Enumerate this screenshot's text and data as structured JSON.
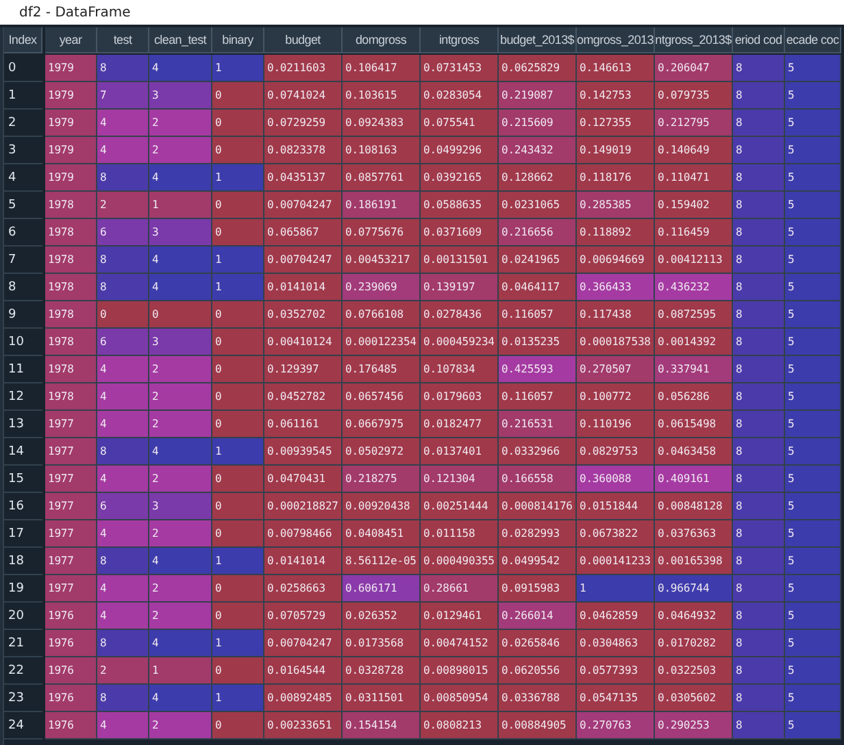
{
  "window": {
    "title": "df2 - DataFrame"
  },
  "table": {
    "index_header": "Index",
    "columns": [
      "year",
      "test",
      "clean_test",
      "binary",
      "budget",
      "domgross",
      "intgross",
      "budget_2013$",
      "omgross_2013",
      "ntgross_2013$",
      "eriod cod",
      "ecade coc"
    ],
    "rows": [
      {
        "index": "0",
        "cells": [
          {
            "value": "1979",
            "color": "#a23a6a"
          },
          {
            "value": "8",
            "color": "#4b3aaa"
          },
          {
            "value": "4",
            "color": "#3c3cac"
          },
          {
            "value": "1",
            "color": "#3c3cac"
          },
          {
            "value": "0.0211603",
            "color": "#a0394a"
          },
          {
            "value": "0.106417",
            "color": "#a0394a"
          },
          {
            "value": "0.0731453",
            "color": "#a0394a"
          },
          {
            "value": "0.0625829",
            "color": "#a0394a"
          },
          {
            "value": "0.146613",
            "color": "#a0394a"
          },
          {
            "value": "0.206047",
            "color": "#a23a6a"
          },
          {
            "value": "8",
            "color": "#4b3aaa"
          },
          {
            "value": "5",
            "color": "#3c3cac"
          }
        ]
      },
      {
        "index": "1",
        "cells": [
          {
            "value": "1979",
            "color": "#a23a6a"
          },
          {
            "value": "7",
            "color": "#7a3aaa"
          },
          {
            "value": "3",
            "color": "#7a3aaa"
          },
          {
            "value": "0",
            "color": "#a0394a"
          },
          {
            "value": "0.0741024",
            "color": "#a0394a"
          },
          {
            "value": "0.103615",
            "color": "#a0394a"
          },
          {
            "value": "0.0283054",
            "color": "#a0394a"
          },
          {
            "value": "0.219087",
            "color": "#a23a6a"
          },
          {
            "value": "0.142753",
            "color": "#a0394a"
          },
          {
            "value": "0.079735",
            "color": "#a0394a"
          },
          {
            "value": "8",
            "color": "#4b3aaa"
          },
          {
            "value": "5",
            "color": "#3c3cac"
          }
        ]
      },
      {
        "index": "2",
        "cells": [
          {
            "value": "1979",
            "color": "#a23a6a"
          },
          {
            "value": "4",
            "color": "#a53aa2"
          },
          {
            "value": "2",
            "color": "#a53aa2"
          },
          {
            "value": "0",
            "color": "#a0394a"
          },
          {
            "value": "0.0729259",
            "color": "#a0394a"
          },
          {
            "value": "0.0924383",
            "color": "#a0394a"
          },
          {
            "value": "0.075541",
            "color": "#a0394a"
          },
          {
            "value": "0.215609",
            "color": "#a23a6a"
          },
          {
            "value": "0.127355",
            "color": "#a0394a"
          },
          {
            "value": "0.212795",
            "color": "#a23a6a"
          },
          {
            "value": "8",
            "color": "#4b3aaa"
          },
          {
            "value": "5",
            "color": "#3c3cac"
          }
        ]
      },
      {
        "index": "3",
        "cells": [
          {
            "value": "1979",
            "color": "#a23a6a"
          },
          {
            "value": "4",
            "color": "#a53aa2"
          },
          {
            "value": "2",
            "color": "#a53aa2"
          },
          {
            "value": "0",
            "color": "#a0394a"
          },
          {
            "value": "0.0823378",
            "color": "#a0394a"
          },
          {
            "value": "0.108163",
            "color": "#a0394a"
          },
          {
            "value": "0.0499296",
            "color": "#a0394a"
          },
          {
            "value": "0.243432",
            "color": "#a23a6a"
          },
          {
            "value": "0.149019",
            "color": "#a0394a"
          },
          {
            "value": "0.140649",
            "color": "#a0394a"
          },
          {
            "value": "8",
            "color": "#4b3aaa"
          },
          {
            "value": "5",
            "color": "#3c3cac"
          }
        ]
      },
      {
        "index": "4",
        "cells": [
          {
            "value": "1979",
            "color": "#a23a6a"
          },
          {
            "value": "8",
            "color": "#4b3aaa"
          },
          {
            "value": "4",
            "color": "#3c3cac"
          },
          {
            "value": "1",
            "color": "#3c3cac"
          },
          {
            "value": "0.0435137",
            "color": "#a0394a"
          },
          {
            "value": "0.0857761",
            "color": "#a0394a"
          },
          {
            "value": "0.0392165",
            "color": "#a0394a"
          },
          {
            "value": "0.128662",
            "color": "#a0394a"
          },
          {
            "value": "0.118176",
            "color": "#a0394a"
          },
          {
            "value": "0.110471",
            "color": "#a0394a"
          },
          {
            "value": "8",
            "color": "#4b3aaa"
          },
          {
            "value": "5",
            "color": "#3c3cac"
          }
        ]
      },
      {
        "index": "5",
        "cells": [
          {
            "value": "1978",
            "color": "#a23a6a"
          },
          {
            "value": "2",
            "color": "#a23a6a"
          },
          {
            "value": "1",
            "color": "#a23a6a"
          },
          {
            "value": "0",
            "color": "#a0394a"
          },
          {
            "value": "0.00704247",
            "color": "#a0394a"
          },
          {
            "value": "0.186191",
            "color": "#a23a6a"
          },
          {
            "value": "0.0588635",
            "color": "#a0394a"
          },
          {
            "value": "0.0231065",
            "color": "#a0394a"
          },
          {
            "value": "0.285385",
            "color": "#a23a6a"
          },
          {
            "value": "0.159402",
            "color": "#a0394a"
          },
          {
            "value": "8",
            "color": "#4b3aaa"
          },
          {
            "value": "5",
            "color": "#3c3cac"
          }
        ]
      },
      {
        "index": "6",
        "cells": [
          {
            "value": "1978",
            "color": "#a23a6a"
          },
          {
            "value": "6",
            "color": "#7a3aaa"
          },
          {
            "value": "3",
            "color": "#7a3aaa"
          },
          {
            "value": "0",
            "color": "#a0394a"
          },
          {
            "value": "0.065867",
            "color": "#a0394a"
          },
          {
            "value": "0.0775676",
            "color": "#a0394a"
          },
          {
            "value": "0.0371609",
            "color": "#a0394a"
          },
          {
            "value": "0.216656",
            "color": "#a23a6a"
          },
          {
            "value": "0.118892",
            "color": "#a0394a"
          },
          {
            "value": "0.116459",
            "color": "#a0394a"
          },
          {
            "value": "8",
            "color": "#4b3aaa"
          },
          {
            "value": "5",
            "color": "#3c3cac"
          }
        ]
      },
      {
        "index": "7",
        "cells": [
          {
            "value": "1978",
            "color": "#a23a6a"
          },
          {
            "value": "8",
            "color": "#4b3aaa"
          },
          {
            "value": "4",
            "color": "#3c3cac"
          },
          {
            "value": "1",
            "color": "#3c3cac"
          },
          {
            "value": "0.00704247",
            "color": "#a0394a"
          },
          {
            "value": "0.00453217",
            "color": "#a0394a"
          },
          {
            "value": "0.00131501",
            "color": "#a0394a"
          },
          {
            "value": "0.0241965",
            "color": "#a0394a"
          },
          {
            "value": "0.00694669",
            "color": "#a0394a"
          },
          {
            "value": "0.00412113",
            "color": "#a0394a"
          },
          {
            "value": "8",
            "color": "#4b3aaa"
          },
          {
            "value": "5",
            "color": "#3c3cac"
          }
        ]
      },
      {
        "index": "8",
        "cells": [
          {
            "value": "1978",
            "color": "#a23a6a"
          },
          {
            "value": "8",
            "color": "#4b3aaa"
          },
          {
            "value": "4",
            "color": "#3c3cac"
          },
          {
            "value": "1",
            "color": "#3c3cac"
          },
          {
            "value": "0.0141014",
            "color": "#a0394a"
          },
          {
            "value": "0.239069",
            "color": "#a33a7a"
          },
          {
            "value": "0.139197",
            "color": "#a23a6a"
          },
          {
            "value": "0.0464117",
            "color": "#a0394a"
          },
          {
            "value": "0.366433",
            "color": "#a53aa2"
          },
          {
            "value": "0.436232",
            "color": "#a53aa2"
          },
          {
            "value": "8",
            "color": "#4b3aaa"
          },
          {
            "value": "5",
            "color": "#3c3cac"
          }
        ]
      },
      {
        "index": "9",
        "cells": [
          {
            "value": "1978",
            "color": "#a23a6a"
          },
          {
            "value": "0",
            "color": "#a0394a"
          },
          {
            "value": "0",
            "color": "#a0394a"
          },
          {
            "value": "0",
            "color": "#a0394a"
          },
          {
            "value": "0.0352702",
            "color": "#a0394a"
          },
          {
            "value": "0.0766108",
            "color": "#a0394a"
          },
          {
            "value": "0.0278436",
            "color": "#a0394a"
          },
          {
            "value": "0.116057",
            "color": "#a0394a"
          },
          {
            "value": "0.117438",
            "color": "#a0394a"
          },
          {
            "value": "0.0872595",
            "color": "#a0394a"
          },
          {
            "value": "8",
            "color": "#4b3aaa"
          },
          {
            "value": "5",
            "color": "#3c3cac"
          }
        ]
      },
      {
        "index": "10",
        "cells": [
          {
            "value": "1978",
            "color": "#a23a6a"
          },
          {
            "value": "6",
            "color": "#7a3aaa"
          },
          {
            "value": "3",
            "color": "#7a3aaa"
          },
          {
            "value": "0",
            "color": "#a0394a"
          },
          {
            "value": "0.00410124",
            "color": "#a0394a"
          },
          {
            "value": "0.000122354",
            "color": "#a0394a"
          },
          {
            "value": "0.000459234",
            "color": "#a0394a"
          },
          {
            "value": "0.0135235",
            "color": "#a0394a"
          },
          {
            "value": "0.000187538",
            "color": "#a0394a"
          },
          {
            "value": "0.0014392",
            "color": "#a0394a"
          },
          {
            "value": "8",
            "color": "#4b3aaa"
          },
          {
            "value": "5",
            "color": "#3c3cac"
          }
        ]
      },
      {
        "index": "11",
        "cells": [
          {
            "value": "1978",
            "color": "#a23a6a"
          },
          {
            "value": "4",
            "color": "#a53aa2"
          },
          {
            "value": "2",
            "color": "#a53aa2"
          },
          {
            "value": "0",
            "color": "#a0394a"
          },
          {
            "value": "0.129397",
            "color": "#a0394a"
          },
          {
            "value": "0.176485",
            "color": "#a0394a"
          },
          {
            "value": "0.107834",
            "color": "#a0394a"
          },
          {
            "value": "0.425593",
            "color": "#a53aa2"
          },
          {
            "value": "0.270507",
            "color": "#a23a6a"
          },
          {
            "value": "0.337941",
            "color": "#a33a7a"
          },
          {
            "value": "8",
            "color": "#4b3aaa"
          },
          {
            "value": "5",
            "color": "#3c3cac"
          }
        ]
      },
      {
        "index": "12",
        "cells": [
          {
            "value": "1978",
            "color": "#a23a6a"
          },
          {
            "value": "4",
            "color": "#a53aa2"
          },
          {
            "value": "2",
            "color": "#a53aa2"
          },
          {
            "value": "0",
            "color": "#a0394a"
          },
          {
            "value": "0.0452782",
            "color": "#a0394a"
          },
          {
            "value": "0.0657456",
            "color": "#a0394a"
          },
          {
            "value": "0.0179603",
            "color": "#a0394a"
          },
          {
            "value": "0.116057",
            "color": "#a0394a"
          },
          {
            "value": "0.100772",
            "color": "#a0394a"
          },
          {
            "value": "0.056286",
            "color": "#a0394a"
          },
          {
            "value": "8",
            "color": "#4b3aaa"
          },
          {
            "value": "5",
            "color": "#3c3cac"
          }
        ]
      },
      {
        "index": "13",
        "cells": [
          {
            "value": "1977",
            "color": "#a23a6a"
          },
          {
            "value": "4",
            "color": "#a53aa2"
          },
          {
            "value": "2",
            "color": "#a53aa2"
          },
          {
            "value": "0",
            "color": "#a0394a"
          },
          {
            "value": "0.061161",
            "color": "#a0394a"
          },
          {
            "value": "0.0667975",
            "color": "#a0394a"
          },
          {
            "value": "0.0182477",
            "color": "#a0394a"
          },
          {
            "value": "0.216531",
            "color": "#a23a6a"
          },
          {
            "value": "0.110196",
            "color": "#a0394a"
          },
          {
            "value": "0.0615498",
            "color": "#a0394a"
          },
          {
            "value": "8",
            "color": "#4b3aaa"
          },
          {
            "value": "5",
            "color": "#3c3cac"
          }
        ]
      },
      {
        "index": "14",
        "cells": [
          {
            "value": "1977",
            "color": "#a23a6a"
          },
          {
            "value": "8",
            "color": "#4b3aaa"
          },
          {
            "value": "4",
            "color": "#3c3cac"
          },
          {
            "value": "1",
            "color": "#3c3cac"
          },
          {
            "value": "0.00939545",
            "color": "#a0394a"
          },
          {
            "value": "0.0502972",
            "color": "#a0394a"
          },
          {
            "value": "0.0137401",
            "color": "#a0394a"
          },
          {
            "value": "0.0332966",
            "color": "#a0394a"
          },
          {
            "value": "0.0829753",
            "color": "#a0394a"
          },
          {
            "value": "0.0463458",
            "color": "#a0394a"
          },
          {
            "value": "8",
            "color": "#4b3aaa"
          },
          {
            "value": "5",
            "color": "#3c3cac"
          }
        ]
      },
      {
        "index": "15",
        "cells": [
          {
            "value": "1977",
            "color": "#a23a6a"
          },
          {
            "value": "4",
            "color": "#a53aa2"
          },
          {
            "value": "2",
            "color": "#a53aa2"
          },
          {
            "value": "0",
            "color": "#a0394a"
          },
          {
            "value": "0.0470431",
            "color": "#a0394a"
          },
          {
            "value": "0.218275",
            "color": "#a23a6a"
          },
          {
            "value": "0.121304",
            "color": "#a23a6a"
          },
          {
            "value": "0.166558",
            "color": "#a23a6a"
          },
          {
            "value": "0.360088",
            "color": "#a53aa2"
          },
          {
            "value": "0.409161",
            "color": "#a53aa2"
          },
          {
            "value": "8",
            "color": "#4b3aaa"
          },
          {
            "value": "5",
            "color": "#3c3cac"
          }
        ]
      },
      {
        "index": "16",
        "cells": [
          {
            "value": "1977",
            "color": "#a23a6a"
          },
          {
            "value": "6",
            "color": "#7a3aaa"
          },
          {
            "value": "3",
            "color": "#7a3aaa"
          },
          {
            "value": "0",
            "color": "#a0394a"
          },
          {
            "value": "0.000218827",
            "color": "#a0394a"
          },
          {
            "value": "0.00920438",
            "color": "#a0394a"
          },
          {
            "value": "0.00251444",
            "color": "#a0394a"
          },
          {
            "value": "0.000814176",
            "color": "#a0394a"
          },
          {
            "value": "0.0151844",
            "color": "#a0394a"
          },
          {
            "value": "0.00848128",
            "color": "#a0394a"
          },
          {
            "value": "8",
            "color": "#4b3aaa"
          },
          {
            "value": "5",
            "color": "#3c3cac"
          }
        ]
      },
      {
        "index": "17",
        "cells": [
          {
            "value": "1977",
            "color": "#a23a6a"
          },
          {
            "value": "4",
            "color": "#a53aa2"
          },
          {
            "value": "2",
            "color": "#a53aa2"
          },
          {
            "value": "0",
            "color": "#a0394a"
          },
          {
            "value": "0.00798466",
            "color": "#a0394a"
          },
          {
            "value": "0.0408451",
            "color": "#a0394a"
          },
          {
            "value": "0.011158",
            "color": "#a0394a"
          },
          {
            "value": "0.0282993",
            "color": "#a0394a"
          },
          {
            "value": "0.0673822",
            "color": "#a0394a"
          },
          {
            "value": "0.0376363",
            "color": "#a0394a"
          },
          {
            "value": "8",
            "color": "#4b3aaa"
          },
          {
            "value": "5",
            "color": "#3c3cac"
          }
        ]
      },
      {
        "index": "18",
        "cells": [
          {
            "value": "1977",
            "color": "#a23a6a"
          },
          {
            "value": "8",
            "color": "#4b3aaa"
          },
          {
            "value": "4",
            "color": "#3c3cac"
          },
          {
            "value": "1",
            "color": "#3c3cac"
          },
          {
            "value": "0.0141014",
            "color": "#a0394a"
          },
          {
            "value": "8.56112e-05",
            "color": "#a0394a"
          },
          {
            "value": "0.000490355",
            "color": "#a0394a"
          },
          {
            "value": "0.0499542",
            "color": "#a0394a"
          },
          {
            "value": "0.000141233",
            "color": "#a0394a"
          },
          {
            "value": "0.00165398",
            "color": "#a0394a"
          },
          {
            "value": "8",
            "color": "#4b3aaa"
          },
          {
            "value": "5",
            "color": "#3c3cac"
          }
        ]
      },
      {
        "index": "19",
        "cells": [
          {
            "value": "1977",
            "color": "#a23a6a"
          },
          {
            "value": "4",
            "color": "#a53aa2"
          },
          {
            "value": "2",
            "color": "#a53aa2"
          },
          {
            "value": "0",
            "color": "#a0394a"
          },
          {
            "value": "0.0258663",
            "color": "#a0394a"
          },
          {
            "value": "0.606171",
            "color": "#8a3aaa"
          },
          {
            "value": "0.28661",
            "color": "#a23a6a"
          },
          {
            "value": "0.0915983",
            "color": "#a0394a"
          },
          {
            "value": "1",
            "color": "#3c3cac"
          },
          {
            "value": "0.966744",
            "color": "#3e3cac"
          },
          {
            "value": "8",
            "color": "#4b3aaa"
          },
          {
            "value": "5",
            "color": "#3c3cac"
          }
        ]
      },
      {
        "index": "20",
        "cells": [
          {
            "value": "1976",
            "color": "#a23a6a"
          },
          {
            "value": "4",
            "color": "#a53aa2"
          },
          {
            "value": "2",
            "color": "#a53aa2"
          },
          {
            "value": "0",
            "color": "#a0394a"
          },
          {
            "value": "0.0705729",
            "color": "#a0394a"
          },
          {
            "value": "0.026352",
            "color": "#a0394a"
          },
          {
            "value": "0.0129461",
            "color": "#a0394a"
          },
          {
            "value": "0.266014",
            "color": "#a33a7a"
          },
          {
            "value": "0.0462859",
            "color": "#a0394a"
          },
          {
            "value": "0.0464932",
            "color": "#a0394a"
          },
          {
            "value": "8",
            "color": "#4b3aaa"
          },
          {
            "value": "5",
            "color": "#3c3cac"
          }
        ]
      },
      {
        "index": "21",
        "cells": [
          {
            "value": "1976",
            "color": "#a23a6a"
          },
          {
            "value": "8",
            "color": "#4b3aaa"
          },
          {
            "value": "4",
            "color": "#3c3cac"
          },
          {
            "value": "1",
            "color": "#3c3cac"
          },
          {
            "value": "0.00704247",
            "color": "#a0394a"
          },
          {
            "value": "0.0173568",
            "color": "#a0394a"
          },
          {
            "value": "0.00474152",
            "color": "#a0394a"
          },
          {
            "value": "0.0265846",
            "color": "#a0394a"
          },
          {
            "value": "0.0304863",
            "color": "#a0394a"
          },
          {
            "value": "0.0170282",
            "color": "#a0394a"
          },
          {
            "value": "8",
            "color": "#4b3aaa"
          },
          {
            "value": "5",
            "color": "#3c3cac"
          }
        ]
      },
      {
        "index": "22",
        "cells": [
          {
            "value": "1976",
            "color": "#a23a6a"
          },
          {
            "value": "2",
            "color": "#a23a6a"
          },
          {
            "value": "1",
            "color": "#a23a6a"
          },
          {
            "value": "0",
            "color": "#a0394a"
          },
          {
            "value": "0.0164544",
            "color": "#a0394a"
          },
          {
            "value": "0.0328728",
            "color": "#a0394a"
          },
          {
            "value": "0.00898015",
            "color": "#a0394a"
          },
          {
            "value": "0.0620556",
            "color": "#a0394a"
          },
          {
            "value": "0.0577393",
            "color": "#a0394a"
          },
          {
            "value": "0.0322503",
            "color": "#a0394a"
          },
          {
            "value": "8",
            "color": "#4b3aaa"
          },
          {
            "value": "5",
            "color": "#3c3cac"
          }
        ]
      },
      {
        "index": "23",
        "cells": [
          {
            "value": "1976",
            "color": "#a23a6a"
          },
          {
            "value": "8",
            "color": "#4b3aaa"
          },
          {
            "value": "4",
            "color": "#3c3cac"
          },
          {
            "value": "1",
            "color": "#3c3cac"
          },
          {
            "value": "0.00892485",
            "color": "#a0394a"
          },
          {
            "value": "0.0311501",
            "color": "#a0394a"
          },
          {
            "value": "0.00850954",
            "color": "#a0394a"
          },
          {
            "value": "0.0336788",
            "color": "#a0394a"
          },
          {
            "value": "0.0547135",
            "color": "#a0394a"
          },
          {
            "value": "0.0305602",
            "color": "#a0394a"
          },
          {
            "value": "8",
            "color": "#4b3aaa"
          },
          {
            "value": "5",
            "color": "#3c3cac"
          }
        ]
      },
      {
        "index": "24",
        "cells": [
          {
            "value": "1976",
            "color": "#a23a6a"
          },
          {
            "value": "4",
            "color": "#a53aa2"
          },
          {
            "value": "2",
            "color": "#a53aa2"
          },
          {
            "value": "0",
            "color": "#a0394a"
          },
          {
            "value": "0.00233651",
            "color": "#a0394a"
          },
          {
            "value": "0.154154",
            "color": "#a23a6a"
          },
          {
            "value": "0.0808213",
            "color": "#a0394a"
          },
          {
            "value": "0.00884905",
            "color": "#a0394a"
          },
          {
            "value": "0.270763",
            "color": "#a33a7a"
          },
          {
            "value": "0.290253",
            "color": "#a33a7a"
          },
          {
            "value": "8",
            "color": "#4b3aaa"
          },
          {
            "value": "5",
            "color": "#3c3cac"
          }
        ]
      }
    ]
  }
}
